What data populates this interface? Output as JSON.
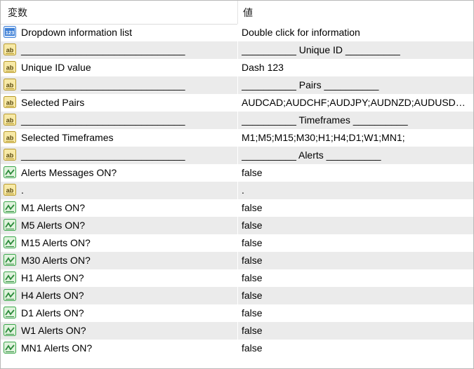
{
  "header": {
    "col_variable": "変数",
    "col_value": "値"
  },
  "rows": [
    {
      "icon": "int",
      "name": "Dropdown information list",
      "value": "Double click for information"
    },
    {
      "icon": "str",
      "name": "______________________________",
      "value": "__________ Unique ID __________"
    },
    {
      "icon": "str",
      "name": "Unique ID value",
      "value": "Dash 123"
    },
    {
      "icon": "str",
      "name": "______________________________",
      "value": "__________ Pairs __________"
    },
    {
      "icon": "str",
      "name": "Selected Pairs",
      "value": "AUDCAD;AUDCHF;AUDJPY;AUDNZD;AUDUSD;C..."
    },
    {
      "icon": "str",
      "name": "______________________________",
      "value": "__________ Timeframes __________"
    },
    {
      "icon": "str",
      "name": "Selected Timeframes",
      "value": "M1;M5;M15;M30;H1;H4;D1;W1;MN1;"
    },
    {
      "icon": "str",
      "name": "______________________________",
      "value": "__________ Alerts __________"
    },
    {
      "icon": "bool",
      "name": "Alerts Messages ON?",
      "value": "false"
    },
    {
      "icon": "str",
      "name": ".",
      "value": "."
    },
    {
      "icon": "bool",
      "name": "M1 Alerts ON?",
      "value": "false"
    },
    {
      "icon": "bool",
      "name": "M5 Alerts ON?",
      "value": "false"
    },
    {
      "icon": "bool",
      "name": "M15 Alerts ON?",
      "value": "false"
    },
    {
      "icon": "bool",
      "name": "M30 Alerts ON?",
      "value": "false"
    },
    {
      "icon": "bool",
      "name": "H1 Alerts ON?",
      "value": "false"
    },
    {
      "icon": "bool",
      "name": "H4 Alerts ON?",
      "value": "false"
    },
    {
      "icon": "bool",
      "name": "D1 Alerts ON?",
      "value": "false"
    },
    {
      "icon": "bool",
      "name": "W1 Alerts ON?",
      "value": "false"
    },
    {
      "icon": "bool",
      "name": "MN1 Alerts ON?",
      "value": "false"
    }
  ],
  "icon_labels": {
    "int": "123",
    "str": "ab"
  },
  "colors": {
    "row_alt": "#ebebeb",
    "int_icon": "#3d7fd6",
    "str_icon": "#e8c95a",
    "bool_icon": "#3aa64a"
  }
}
